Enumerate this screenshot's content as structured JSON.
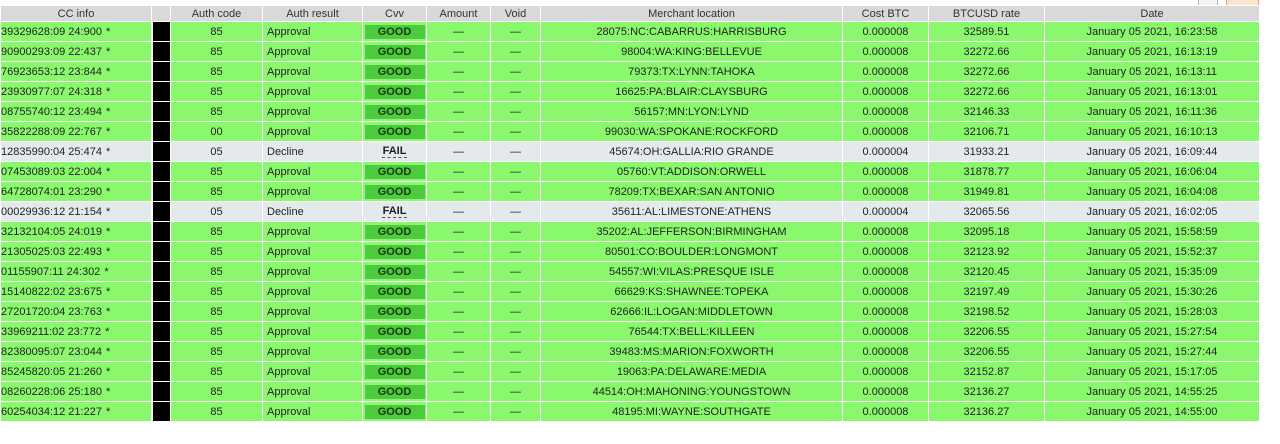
{
  "columns": [
    "CC info",
    "",
    "Auth code",
    "Auth result",
    "Cvv",
    "Amount",
    "Void",
    "Merchant location",
    "Cost BTC",
    "BTCUSD rate",
    "Date"
  ],
  "rows": [
    {
      "cc": "39329628:09 24:900",
      "mark": "*",
      "auth": "85",
      "result": "Approval",
      "cvv": "GOOD",
      "amount": "—",
      "void": "—",
      "location": "28075:NC:CABARRUS:HARRISBURG",
      "cost": "0.000008",
      "rate": "32589.51",
      "date": "January 05 2021, 16:23:58",
      "status": "approve"
    },
    {
      "cc": "90900293:09 22:437",
      "mark": "*",
      "auth": "85",
      "result": "Approval",
      "cvv": "GOOD",
      "amount": "—",
      "void": "—",
      "location": "98004:WA:KING:BELLEVUE",
      "cost": "0.000008",
      "rate": "32272.66",
      "date": "January 05 2021, 16:13:19",
      "status": "approve"
    },
    {
      "cc": "76923653:12 23:844",
      "mark": "*",
      "auth": "85",
      "result": "Approval",
      "cvv": "GOOD",
      "amount": "—",
      "void": "—",
      "location": "79373:TX:LYNN:TAHOKA",
      "cost": "0.000008",
      "rate": "32272.66",
      "date": "January 05 2021, 16:13:11",
      "status": "approve"
    },
    {
      "cc": "23930977:07 24:318",
      "mark": "*",
      "auth": "85",
      "result": "Approval",
      "cvv": "GOOD",
      "amount": "—",
      "void": "—",
      "location": "16625:PA:BLAIR:CLAYSBURG",
      "cost": "0.000008",
      "rate": "32272.66",
      "date": "January 05 2021, 16:13:01",
      "status": "approve"
    },
    {
      "cc": "08755740:12 23:494",
      "mark": "*",
      "auth": "85",
      "result": "Approval",
      "cvv": "GOOD",
      "amount": "—",
      "void": "—",
      "location": "56157:MN:LYON:LYND",
      "cost": "0.000008",
      "rate": "32146.33",
      "date": "January 05 2021, 16:11:36",
      "status": "approve"
    },
    {
      "cc": "35822288:09 22:767",
      "mark": "*",
      "auth": "00",
      "result": "Approval",
      "cvv": "GOOD",
      "amount": "—",
      "void": "—",
      "location": "99030:WA:SPOKANE:ROCKFORD",
      "cost": "0.000008",
      "rate": "32106.71",
      "date": "January 05 2021, 16:10:13",
      "status": "approve"
    },
    {
      "cc": "12835990:04 25:474",
      "mark": "*",
      "auth": "05",
      "result": "Decline",
      "cvv": "FAIL",
      "amount": "—",
      "void": "—",
      "location": "45674:OH:GALLIA:RIO GRANDE",
      "cost": "0.000004",
      "rate": "31933.21",
      "date": "January 05 2021, 16:09:44",
      "status": "decline"
    },
    {
      "cc": "07453089:03 22:004",
      "mark": "*",
      "auth": "85",
      "result": "Approval",
      "cvv": "GOOD",
      "amount": "—",
      "void": "—",
      "location": "05760:VT:ADDISON:ORWELL",
      "cost": "0.000008",
      "rate": "31878.77",
      "date": "January 05 2021, 16:06:04",
      "status": "approve"
    },
    {
      "cc": "64728074:01 23:290",
      "mark": "*",
      "auth": "85",
      "result": "Approval",
      "cvv": "GOOD",
      "amount": "—",
      "void": "—",
      "location": "78209:TX:BEXAR:SAN ANTONIO",
      "cost": "0.000008",
      "rate": "31949.81",
      "date": "January 05 2021, 16:04:08",
      "status": "approve"
    },
    {
      "cc": "00029936:12 21:154",
      "mark": "*",
      "auth": "05",
      "result": "Decline",
      "cvv": "FAIL",
      "amount": "—",
      "void": "—",
      "location": "35611:AL:LIMESTONE:ATHENS",
      "cost": "0.000004",
      "rate": "32065.56",
      "date": "January 05 2021, 16:02:05",
      "status": "decline"
    },
    {
      "cc": "32132104:05 24:019",
      "mark": "*",
      "auth": "85",
      "result": "Approval",
      "cvv": "GOOD",
      "amount": "—",
      "void": "—",
      "location": "35202:AL:JEFFERSON:BIRMINGHAM",
      "cost": "0.000008",
      "rate": "32095.18",
      "date": "January 05 2021, 15:58:59",
      "status": "approve"
    },
    {
      "cc": "21305025:03 22:493",
      "mark": "*",
      "auth": "85",
      "result": "Approval",
      "cvv": "GOOD",
      "amount": "—",
      "void": "—",
      "location": "80501:CO:BOULDER:LONGMONT",
      "cost": "0.000008",
      "rate": "32123.92",
      "date": "January 05 2021, 15:52:37",
      "status": "approve"
    },
    {
      "cc": "01155907:11 24:302",
      "mark": "*",
      "auth": "85",
      "result": "Approval",
      "cvv": "GOOD",
      "amount": "—",
      "void": "—",
      "location": "54557:WI:VILAS:PRESQUE ISLE",
      "cost": "0.000008",
      "rate": "32120.45",
      "date": "January 05 2021, 15:35:09",
      "status": "approve"
    },
    {
      "cc": "15140822:02 23:675",
      "mark": "*",
      "auth": "85",
      "result": "Approval",
      "cvv": "GOOD",
      "amount": "—",
      "void": "—",
      "location": "66629:KS:SHAWNEE:TOPEKA",
      "cost": "0.000008",
      "rate": "32197.49",
      "date": "January 05 2021, 15:30:26",
      "status": "approve"
    },
    {
      "cc": "27201720:04 23:763",
      "mark": "*",
      "auth": "85",
      "result": "Approval",
      "cvv": "GOOD",
      "amount": "—",
      "void": "—",
      "location": "62666:IL:LOGAN:MIDDLETOWN",
      "cost": "0.000008",
      "rate": "32198.52",
      "date": "January 05 2021, 15:28:03",
      "status": "approve"
    },
    {
      "cc": "33969211:02 23:772",
      "mark": "*",
      "auth": "85",
      "result": "Approval",
      "cvv": "GOOD",
      "amount": "—",
      "void": "—",
      "location": "76544:TX:BELL:KILLEEN",
      "cost": "0.000008",
      "rate": "32206.55",
      "date": "January 05 2021, 15:27:54",
      "status": "approve"
    },
    {
      "cc": "82380095:07 23:044",
      "mark": "*",
      "auth": "85",
      "result": "Approval",
      "cvv": "GOOD",
      "amount": "—",
      "void": "—",
      "location": "39483:MS:MARION:FOXWORTH",
      "cost": "0.000008",
      "rate": "32206.55",
      "date": "January 05 2021, 15:27:44",
      "status": "approve"
    },
    {
      "cc": "85245820:05 21:260",
      "mark": "*",
      "auth": "85",
      "result": "Approval",
      "cvv": "GOOD",
      "amount": "—",
      "void": "—",
      "location": "19063:PA:DELAWARE:MEDIA",
      "cost": "0.000008",
      "rate": "32152.87",
      "date": "January 05 2021, 15:17:05",
      "status": "approve"
    },
    {
      "cc": "08260228:06 25:180",
      "mark": "*",
      "auth": "85",
      "result": "Approval",
      "cvv": "GOOD",
      "amount": "—",
      "void": "—",
      "location": "44514:OH:MAHONING:YOUNGSTOWN",
      "cost": "0.000008",
      "rate": "32136.27",
      "date": "January 05 2021, 14:55:25",
      "status": "approve"
    },
    {
      "cc": "60254034:12 21:227",
      "mark": "*",
      "auth": "85",
      "result": "Approval",
      "cvv": "GOOD",
      "amount": "—",
      "void": "—",
      "location": "48195:MI:WAYNE:SOUTHGATE",
      "cost": "0.000008",
      "rate": "32136.27",
      "date": "January 05 2021, 14:55:00",
      "status": "approve"
    }
  ]
}
